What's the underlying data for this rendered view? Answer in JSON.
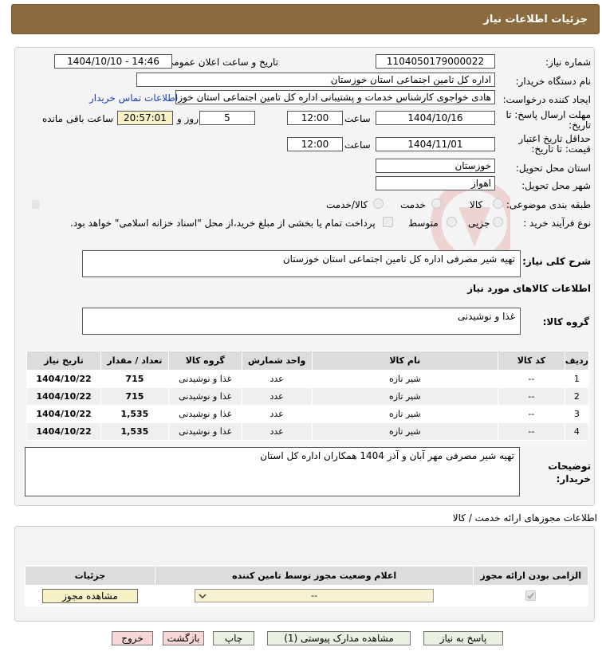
{
  "title": "جزئیات اطلاعات نیاز",
  "form": {
    "need_number_label": "شماره نیاز:",
    "need_number": "1104050179000022",
    "announce_label": "تاریخ و ساعت اعلان عمومی:",
    "announce_value": "1404/10/10 - 14:46",
    "buyer_label": "نام دستگاه خریدار:",
    "buyer_value": "اداره کل تامین اجتماعی استان خوزستان",
    "creator_label": "ایجاد کننده درخواست:",
    "creator_value": "هادی خواجوی کارشناس خدمات و پشتیبانی اداره کل تامین اجتماعی استان خوزستان",
    "contact_link": "اطلاعات تماس خریدار",
    "deadline_label_1": "مهلت ارسال پاسخ: تا",
    "deadline_label_2": "تاریخ:",
    "deadline_date": "1404/10/16",
    "time_label": "ساعت",
    "deadline_time": "12:00",
    "days": "5",
    "days_label": "روز و",
    "remaining": "20:57:01",
    "remaining_label": "ساعت باقی مانده",
    "validity_label_1": "حداقل تاریخ اعتبار",
    "validity_label_2": "قیمت: تا تاریخ:",
    "validity_date": "1404/11/01",
    "validity_time": "12:00",
    "province_label": "استان محل تحویل:",
    "province": "خوزستان",
    "city_label": "شهر محل تحویل:",
    "city": "اهواز",
    "category_label": "طبقه بندی موضوعی:",
    "category_options": [
      "کالا",
      "خدمت",
      "کالا/خدمت"
    ],
    "process_label": "نوع فرآیند خرید :",
    "process_options": [
      "جزیی",
      "متوسط"
    ],
    "payment_note": "پرداخت تمام یا بخشی از مبلغ خرید،از محل \"اسناد خزانه اسلامی\" خواهد بود.",
    "summary_label": "شرح کلی نیاز:",
    "summary": "تهیه شیر مصرفی اداره کل تامین اجتماعی استان خوزستان",
    "goods_info_title": "اطلاعات کالاهای مورد نیاز",
    "goods_group_label": "گروه کالا:",
    "goods_group": "غذا و نوشیدنی",
    "buyer_notes_label_1": "توضیحات",
    "buyer_notes_label_2": "خریدار:",
    "buyer_notes": "تهیه شیر مصرفی مهر آبان و آذر 1404 همکاران اداره کل استان"
  },
  "goods_table": {
    "headers": [
      "ردیف",
      "کد کالا",
      "نام کالا",
      "واحد شمارش",
      "گروه کالا",
      "تعداد / مقدار",
      "تاریخ نیاز"
    ],
    "rows": [
      [
        "1",
        "--",
        "شیر تازه",
        "عدد",
        "غذا و نوشیدنی",
        "715",
        "1404/10/22"
      ],
      [
        "2",
        "--",
        "شیر تازه",
        "عدد",
        "غذا و نوشیدنی",
        "715",
        "1404/10/22"
      ],
      [
        "3",
        "--",
        "شیر تازه",
        "عدد",
        "غذا و نوشیدنی",
        "1,535",
        "1404/10/22"
      ],
      [
        "4",
        "--",
        "شیر تازه",
        "عدد",
        "غذا و نوشیدنی",
        "1,535",
        "1404/10/22"
      ]
    ]
  },
  "permits": {
    "section_title": "اطلاعات مجوزهای ارائه خدمت / کالا",
    "headers": [
      "الزامی بودن ارائه مجوز",
      "اعلام وضعیت مجوز توسط تامین کننده",
      "جزئیات"
    ],
    "select_value": "--",
    "view_button": "مشاهده مجوز"
  },
  "buttons": {
    "reply": "پاسخ به نیاز",
    "docs": "مشاهده مدارک پیوستی (1)",
    "print": "چاپ",
    "back": "بازگشت",
    "exit": "خروج"
  },
  "watermark": "AriaTender.neT"
}
